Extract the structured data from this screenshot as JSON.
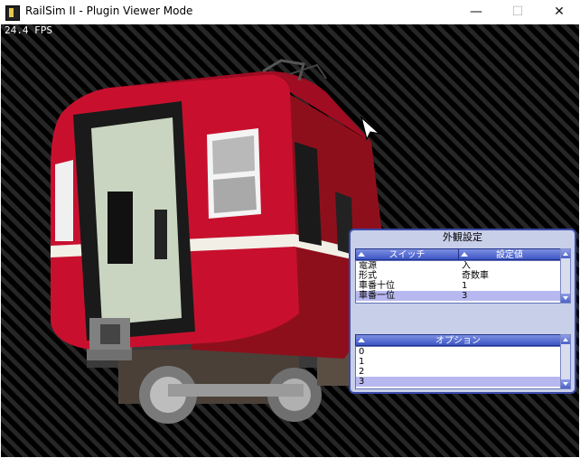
{
  "window": {
    "title": "RailSim II - Plugin Viewer Mode",
    "minimize": "—",
    "maximize": "☐",
    "close": "✕"
  },
  "viewport": {
    "fps": "24.4 FPS"
  },
  "panel": {
    "title": "外観設定",
    "switch_header": "スイッチ",
    "value_header": "設定値",
    "switches": [
      {
        "name": "電源",
        "value": "入"
      },
      {
        "name": "形式",
        "value": "奇数車"
      },
      {
        "name": "車番十位",
        "value": "1"
      },
      {
        "name": "車番一位",
        "value": "3"
      }
    ],
    "options_header": "オプション",
    "options": [
      "0",
      "1",
      "2",
      "3"
    ]
  },
  "colors": {
    "train_body": "#c8102e",
    "panel_accent": "#3e56c6",
    "stripe": "#f2efe6"
  }
}
